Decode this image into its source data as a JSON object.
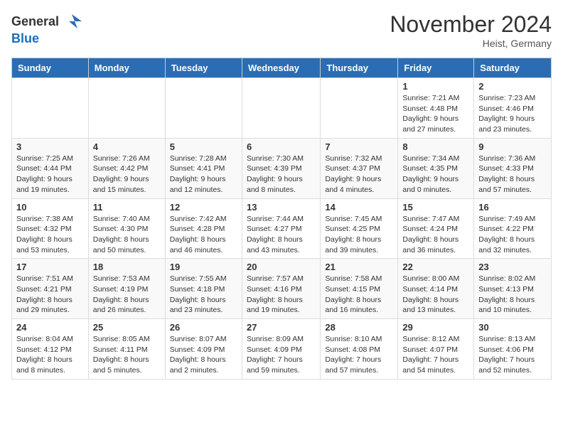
{
  "logo": {
    "general": "General",
    "blue": "Blue"
  },
  "header": {
    "month": "November 2024",
    "location": "Heist, Germany"
  },
  "weekdays": [
    "Sunday",
    "Monday",
    "Tuesday",
    "Wednesday",
    "Thursday",
    "Friday",
    "Saturday"
  ],
  "weeks": [
    [
      {
        "day": "",
        "info": ""
      },
      {
        "day": "",
        "info": ""
      },
      {
        "day": "",
        "info": ""
      },
      {
        "day": "",
        "info": ""
      },
      {
        "day": "",
        "info": ""
      },
      {
        "day": "1",
        "info": "Sunrise: 7:21 AM\nSunset: 4:48 PM\nDaylight: 9 hours and 27 minutes."
      },
      {
        "day": "2",
        "info": "Sunrise: 7:23 AM\nSunset: 4:46 PM\nDaylight: 9 hours and 23 minutes."
      }
    ],
    [
      {
        "day": "3",
        "info": "Sunrise: 7:25 AM\nSunset: 4:44 PM\nDaylight: 9 hours and 19 minutes."
      },
      {
        "day": "4",
        "info": "Sunrise: 7:26 AM\nSunset: 4:42 PM\nDaylight: 9 hours and 15 minutes."
      },
      {
        "day": "5",
        "info": "Sunrise: 7:28 AM\nSunset: 4:41 PM\nDaylight: 9 hours and 12 minutes."
      },
      {
        "day": "6",
        "info": "Sunrise: 7:30 AM\nSunset: 4:39 PM\nDaylight: 9 hours and 8 minutes."
      },
      {
        "day": "7",
        "info": "Sunrise: 7:32 AM\nSunset: 4:37 PM\nDaylight: 9 hours and 4 minutes."
      },
      {
        "day": "8",
        "info": "Sunrise: 7:34 AM\nSunset: 4:35 PM\nDaylight: 9 hours and 0 minutes."
      },
      {
        "day": "9",
        "info": "Sunrise: 7:36 AM\nSunset: 4:33 PM\nDaylight: 8 hours and 57 minutes."
      }
    ],
    [
      {
        "day": "10",
        "info": "Sunrise: 7:38 AM\nSunset: 4:32 PM\nDaylight: 8 hours and 53 minutes."
      },
      {
        "day": "11",
        "info": "Sunrise: 7:40 AM\nSunset: 4:30 PM\nDaylight: 8 hours and 50 minutes."
      },
      {
        "day": "12",
        "info": "Sunrise: 7:42 AM\nSunset: 4:28 PM\nDaylight: 8 hours and 46 minutes."
      },
      {
        "day": "13",
        "info": "Sunrise: 7:44 AM\nSunset: 4:27 PM\nDaylight: 8 hours and 43 minutes."
      },
      {
        "day": "14",
        "info": "Sunrise: 7:45 AM\nSunset: 4:25 PM\nDaylight: 8 hours and 39 minutes."
      },
      {
        "day": "15",
        "info": "Sunrise: 7:47 AM\nSunset: 4:24 PM\nDaylight: 8 hours and 36 minutes."
      },
      {
        "day": "16",
        "info": "Sunrise: 7:49 AM\nSunset: 4:22 PM\nDaylight: 8 hours and 32 minutes."
      }
    ],
    [
      {
        "day": "17",
        "info": "Sunrise: 7:51 AM\nSunset: 4:21 PM\nDaylight: 8 hours and 29 minutes."
      },
      {
        "day": "18",
        "info": "Sunrise: 7:53 AM\nSunset: 4:19 PM\nDaylight: 8 hours and 26 minutes."
      },
      {
        "day": "19",
        "info": "Sunrise: 7:55 AM\nSunset: 4:18 PM\nDaylight: 8 hours and 23 minutes."
      },
      {
        "day": "20",
        "info": "Sunrise: 7:57 AM\nSunset: 4:16 PM\nDaylight: 8 hours and 19 minutes."
      },
      {
        "day": "21",
        "info": "Sunrise: 7:58 AM\nSunset: 4:15 PM\nDaylight: 8 hours and 16 minutes."
      },
      {
        "day": "22",
        "info": "Sunrise: 8:00 AM\nSunset: 4:14 PM\nDaylight: 8 hours and 13 minutes."
      },
      {
        "day": "23",
        "info": "Sunrise: 8:02 AM\nSunset: 4:13 PM\nDaylight: 8 hours and 10 minutes."
      }
    ],
    [
      {
        "day": "24",
        "info": "Sunrise: 8:04 AM\nSunset: 4:12 PM\nDaylight: 8 hours and 8 minutes."
      },
      {
        "day": "25",
        "info": "Sunrise: 8:05 AM\nSunset: 4:11 PM\nDaylight: 8 hours and 5 minutes."
      },
      {
        "day": "26",
        "info": "Sunrise: 8:07 AM\nSunset: 4:09 PM\nDaylight: 8 hours and 2 minutes."
      },
      {
        "day": "27",
        "info": "Sunrise: 8:09 AM\nSunset: 4:09 PM\nDaylight: 7 hours and 59 minutes."
      },
      {
        "day": "28",
        "info": "Sunrise: 8:10 AM\nSunset: 4:08 PM\nDaylight: 7 hours and 57 minutes."
      },
      {
        "day": "29",
        "info": "Sunrise: 8:12 AM\nSunset: 4:07 PM\nDaylight: 7 hours and 54 minutes."
      },
      {
        "day": "30",
        "info": "Sunrise: 8:13 AM\nSunset: 4:06 PM\nDaylight: 7 hours and 52 minutes."
      }
    ]
  ]
}
